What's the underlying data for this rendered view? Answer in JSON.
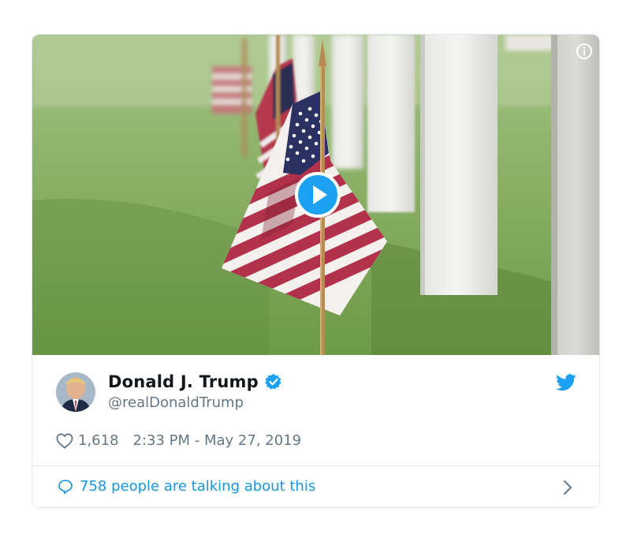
{
  "tweet": {
    "display_name": "Donald J. Trump",
    "handle": "@realDonaldTrump",
    "likes": "1,618",
    "timestamp": "2:33 PM - May 27, 2019",
    "conversation_text": "758 people are talking about this"
  },
  "media": {
    "kind": "video",
    "description_icon": "info-icon",
    "play_icon": "play-icon"
  },
  "icons": {
    "brand": "twitter-bird-icon",
    "verified": "verified-badge-icon",
    "like": "heart-icon",
    "reply": "speech-bubble-icon",
    "more": "chevron-right-icon"
  },
  "colors": {
    "twitter_blue": "#1da1f2",
    "link_blue": "#1b95e0",
    "muted_text": "#657786",
    "name_text": "#14171a",
    "border": "#e1e8ed"
  }
}
